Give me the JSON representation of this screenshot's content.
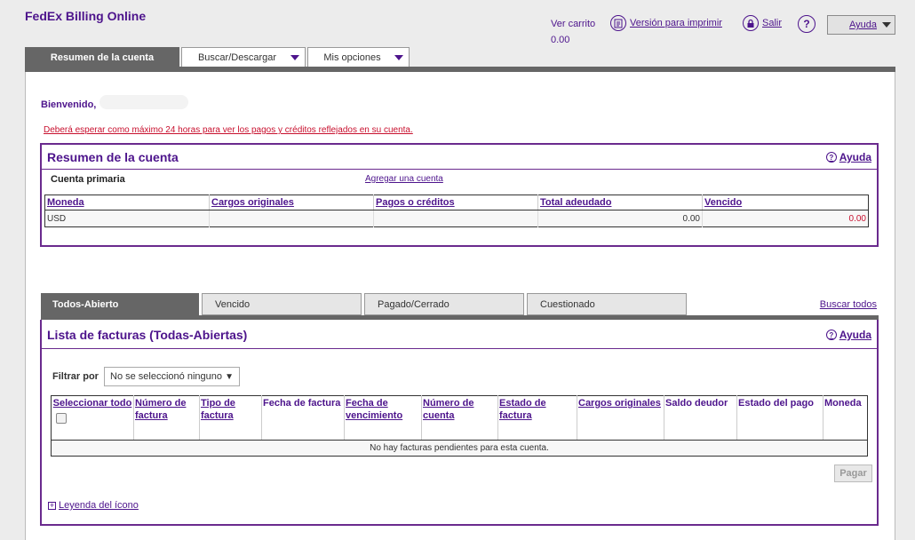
{
  "header": {
    "app_title": "FedEx Billing Online",
    "cart_label": "Ver carrito",
    "cart_amount": "0.00",
    "print_label": "Versión para imprimir",
    "exit_label": "Salir",
    "help_q": "?",
    "help_label": "Ayuda"
  },
  "main_tabs": [
    {
      "label": "Resumen de la cuenta"
    },
    {
      "label": "Buscar/Descargar"
    },
    {
      "label": "Mis opciones"
    }
  ],
  "welcome": {
    "label": "Bienvenido,",
    "notice": "Deberá esperar como máximo 24 horas para ver los pagos y créditos reflejados en su cuenta."
  },
  "summary": {
    "title": "Resumen de la cuenta",
    "help": "Ayuda",
    "primary_label": "Cuenta primaria",
    "add_account": "Agregar una cuenta",
    "columns": [
      "Moneda",
      "Cargos originales",
      "Pagos o créditos",
      "Total adeudado",
      "Vencido"
    ],
    "row": {
      "currency": "USD",
      "charges": "",
      "payments": "",
      "total": "0.00",
      "overdue": "0.00"
    },
    "overdue_color": "#c8102e"
  },
  "invoice_tabs": [
    {
      "label": "Todos-Abierto"
    },
    {
      "label": "Vencido"
    },
    {
      "label": "Pagado/Cerrado"
    },
    {
      "label": "Cuestionado"
    }
  ],
  "search_all": "Buscar todos",
  "invoices": {
    "title": "Lista de facturas (Todas-Abiertas)",
    "help": "Ayuda",
    "filter_label": "Filtrar por",
    "filter_value": "No se seleccionó ninguno",
    "columns": [
      "Seleccionar todo",
      "Número de factura",
      "Tipo de factura",
      "Fecha de factura",
      "Fecha de vencimiento",
      "Número de cuenta",
      "Estado de factura",
      "Cargos originales",
      "Saldo deudor",
      "Estado del pago",
      "Moneda"
    ],
    "empty_message": "No hay facturas pendientes para esta cuenta.",
    "pay_button": "Pagar",
    "legend_link": "Leyenda del ícono"
  },
  "colors": {
    "accent": "#4d148c",
    "tab_active": "#666666",
    "alert": "#c8102e"
  }
}
